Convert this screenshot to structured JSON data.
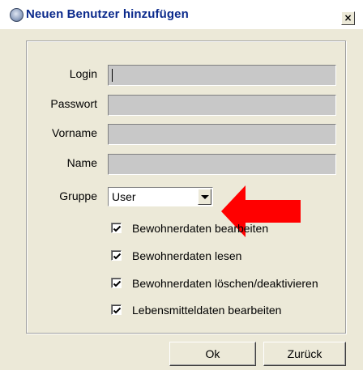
{
  "window": {
    "title": "Neuen Benutzer hinzufügen",
    "close_glyph": "×",
    "icon": "user-group-icon"
  },
  "form": {
    "login": {
      "label": "Login",
      "value": ""
    },
    "password": {
      "label": "Passwort",
      "value": ""
    },
    "firstname": {
      "label": "Vorname",
      "value": ""
    },
    "lastname": {
      "label": "Name",
      "value": ""
    },
    "group": {
      "label": "Gruppe",
      "value": "User"
    }
  },
  "permissions": [
    {
      "label": "Bewohnerdaten bearbeiten",
      "checked": true
    },
    {
      "label": "Bewohnerdaten lesen",
      "checked": true
    },
    {
      "label": "Bewohnerdaten löschen/deaktivieren",
      "checked": true
    },
    {
      "label": "Lebensmitteldaten bearbeiten",
      "checked": true
    }
  ],
  "buttons": {
    "ok": "Ok",
    "back": "Zurück"
  },
  "colors": {
    "title_text": "#0b2a8c",
    "dialog_bg": "#ece9d8",
    "field_bg": "#c8c8c8",
    "annotation_arrow": "#ff0000"
  }
}
